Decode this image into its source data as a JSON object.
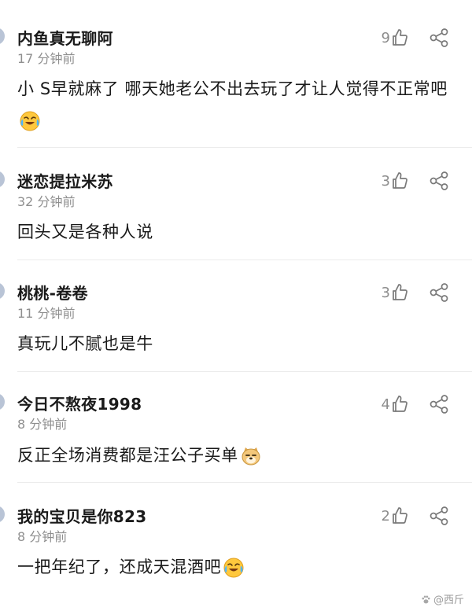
{
  "comments": [
    {
      "username": "内鱼真无聊阿",
      "time": "17 分钟前",
      "text": "小 S早就麻了 哪天她老公不出去玩了才让人觉得不正常吧",
      "emoji": "laugh-cry-emoji",
      "likes": "9"
    },
    {
      "username": "迷恋提拉米苏",
      "time": "32 分钟前",
      "text": "回头又是各种人说",
      "emoji": "",
      "likes": "3"
    },
    {
      "username": "桃桃-卷卷",
      "time": "11 分钟前",
      "text": "真玩儿不腻也是牛",
      "emoji": "",
      "likes": "3"
    },
    {
      "username": "今日不熬夜1998",
      "time": "8 分钟前",
      "text": "反正全场消费都是汪公子买单",
      "emoji": "doge-emoji",
      "likes": "4"
    },
    {
      "username": "我的宝贝是你823",
      "time": "8 分钟前",
      "text": "一把年纪了，还成天混酒吧",
      "emoji": "laugh-cry-emoji",
      "likes": "2"
    }
  ],
  "watermark": "@西斤",
  "colors": {
    "text": "#1a1a1a",
    "meta": "#8f8f8f",
    "icon": "#7a7a7a",
    "divider": "#ececec"
  }
}
